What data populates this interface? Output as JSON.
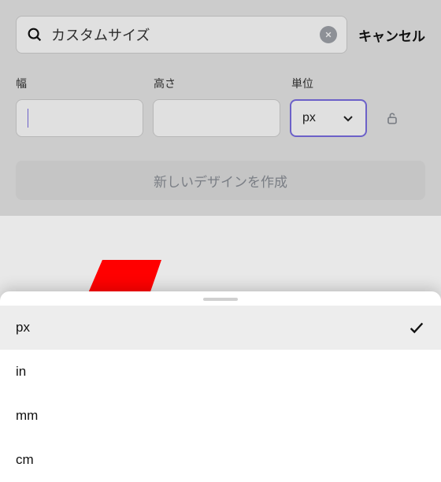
{
  "search": {
    "query": "カスタムサイズ",
    "cancel_label": "キャンセル"
  },
  "labels": {
    "width": "幅",
    "height": "高さ",
    "unit": "単位"
  },
  "inputs": {
    "width_value": "",
    "height_value": ""
  },
  "unit": {
    "selected": "px",
    "options": [
      {
        "label": "px",
        "selected": true
      },
      {
        "label": "in",
        "selected": false
      },
      {
        "label": "mm",
        "selected": false
      },
      {
        "label": "cm",
        "selected": false
      }
    ]
  },
  "create_button_label": "新しいデザインを作成",
  "annotation": {
    "color": "#ff0000",
    "points_to": "mm"
  }
}
